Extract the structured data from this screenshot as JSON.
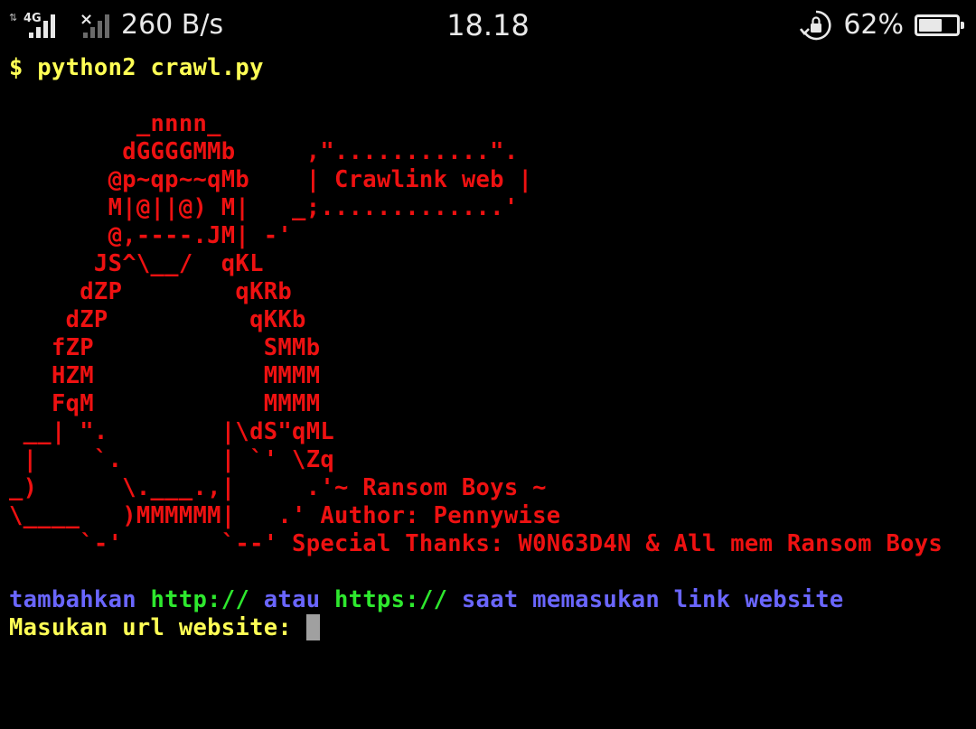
{
  "status_bar": {
    "network_type": "4G",
    "net_speed": "260 B/s",
    "time": "18.18",
    "battery_percent": "62%",
    "battery_level": 0.62,
    "icons": [
      "signal-sim1-icon",
      "signal-sim2-no-service-icon",
      "rotation-lock-icon",
      "battery-icon"
    ]
  },
  "terminal": {
    "prompt_line": "$ python2 crawl.py",
    "ascii_art": [
      "",
      "         _nnnn_",
      "        dGGGGMMb     ,\"...........\".",
      "       @p~qp~~qMb    | Crawlink web |",
      "       M|@||@) M|   _;.............'",
      "       @,----.JM| -'",
      "      JS^\\__/  qKL",
      "     dZP        qKRb",
      "    dZP          qKKb",
      "   fZP            SMMb",
      "   HZM            MMMM",
      "   FqM            MMMM",
      " __| \".        |\\dS\"qML",
      " |    `.       | `' \\Zq",
      "_)      \\.___.,|     .'~ Ransom Boys ~",
      "\\____   )MMMMMM|   .' Author: Pennywise",
      "     `-'       `--' Special Thanks: W0N63D4N & All mem Ransom Boys",
      ""
    ],
    "hint_segments": [
      {
        "text": "tambahkan ",
        "color": "blue"
      },
      {
        "text": "http://",
        "color": "green"
      },
      {
        "text": " atau ",
        "color": "blue"
      },
      {
        "text": "https://",
        "color": "green"
      },
      {
        "text": " saat memasukan link website",
        "color": "blue"
      }
    ],
    "input_prompt": "Masukan url website: ",
    "input_value": ""
  },
  "colors": {
    "background": "#000000",
    "prompt": "#ffff55",
    "art": "#ee1111",
    "hint_blue": "#6a66ff",
    "hint_green": "#2ee82e",
    "cursor": "#a0a0a0"
  }
}
